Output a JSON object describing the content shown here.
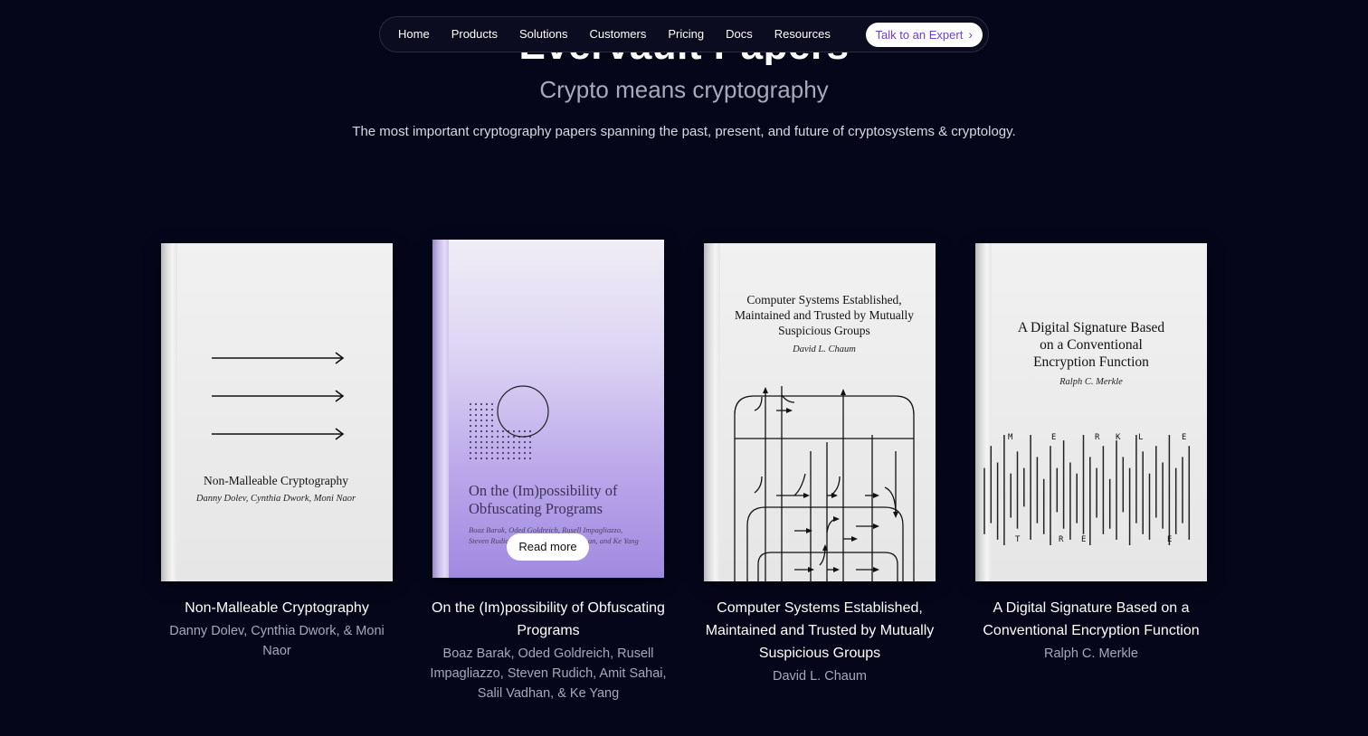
{
  "nav": {
    "items": [
      "Home",
      "Products",
      "Solutions",
      "Customers",
      "Pricing",
      "Docs",
      "Resources"
    ],
    "cta_label": "Talk to an Expert",
    "cta_icon": "chevron-right-icon",
    "cta_color": "#6b3fd6"
  },
  "hero": {
    "title": "Evervault Papers",
    "subtitle": "Crypto means cryptography",
    "tagline": "The most important cryptography papers spanning the past, present, and future of cryptosystems & cryptology."
  },
  "papers": [
    {
      "cover_title": "Non-Malleable Cryptography",
      "cover_authors": "Danny Dolev, Cynthia Dwork, Moni Naor",
      "title": "Non-Malleable Cryptography",
      "authors": "Danny Dolev, Cynthia Dwork, & Moni Naor"
    },
    {
      "cover_title": "On the (Im)possibility of Obfuscating Programs",
      "cover_authors_line1": "Boaz Barak, Oded Goldreich, Rusell Impagliazzo,",
      "cover_authors_line2_left": "Steven Rudic",
      "cover_authors_line2_right": "an, and Ke Yang",
      "read_more": "Read more",
      "title": "On the (Im)possibility of Obfuscating Programs",
      "authors": "Boaz Barak, Oded Goldreich, Rusell Impagliazzo, Steven Rudich, Amit Sahai, Salil Vadhan, & Ke Yang",
      "accent": "#a08ae0"
    },
    {
      "cover_title": "Computer Systems Established, Maintained and Trusted by Mutually Suspicious Groups",
      "cover_authors": "David L. Chaum",
      "title": "Computer Systems Established, Maintained and Trusted by Mutually Suspicious Groups",
      "authors": "David L. Chaum"
    },
    {
      "cover_title": "A Digital Signature Based on a Conventional Encryption Function",
      "cover_authors": "Ralph C. Merkle",
      "cover_letters_top": [
        "M",
        "E",
        "R",
        "K",
        "L",
        "E"
      ],
      "cover_letters_bottom": [
        "T",
        "R",
        "E",
        "E"
      ],
      "title": "A Digital Signature Based on a Conventional Encryption Function",
      "authors": "Ralph C. Merkle"
    }
  ]
}
